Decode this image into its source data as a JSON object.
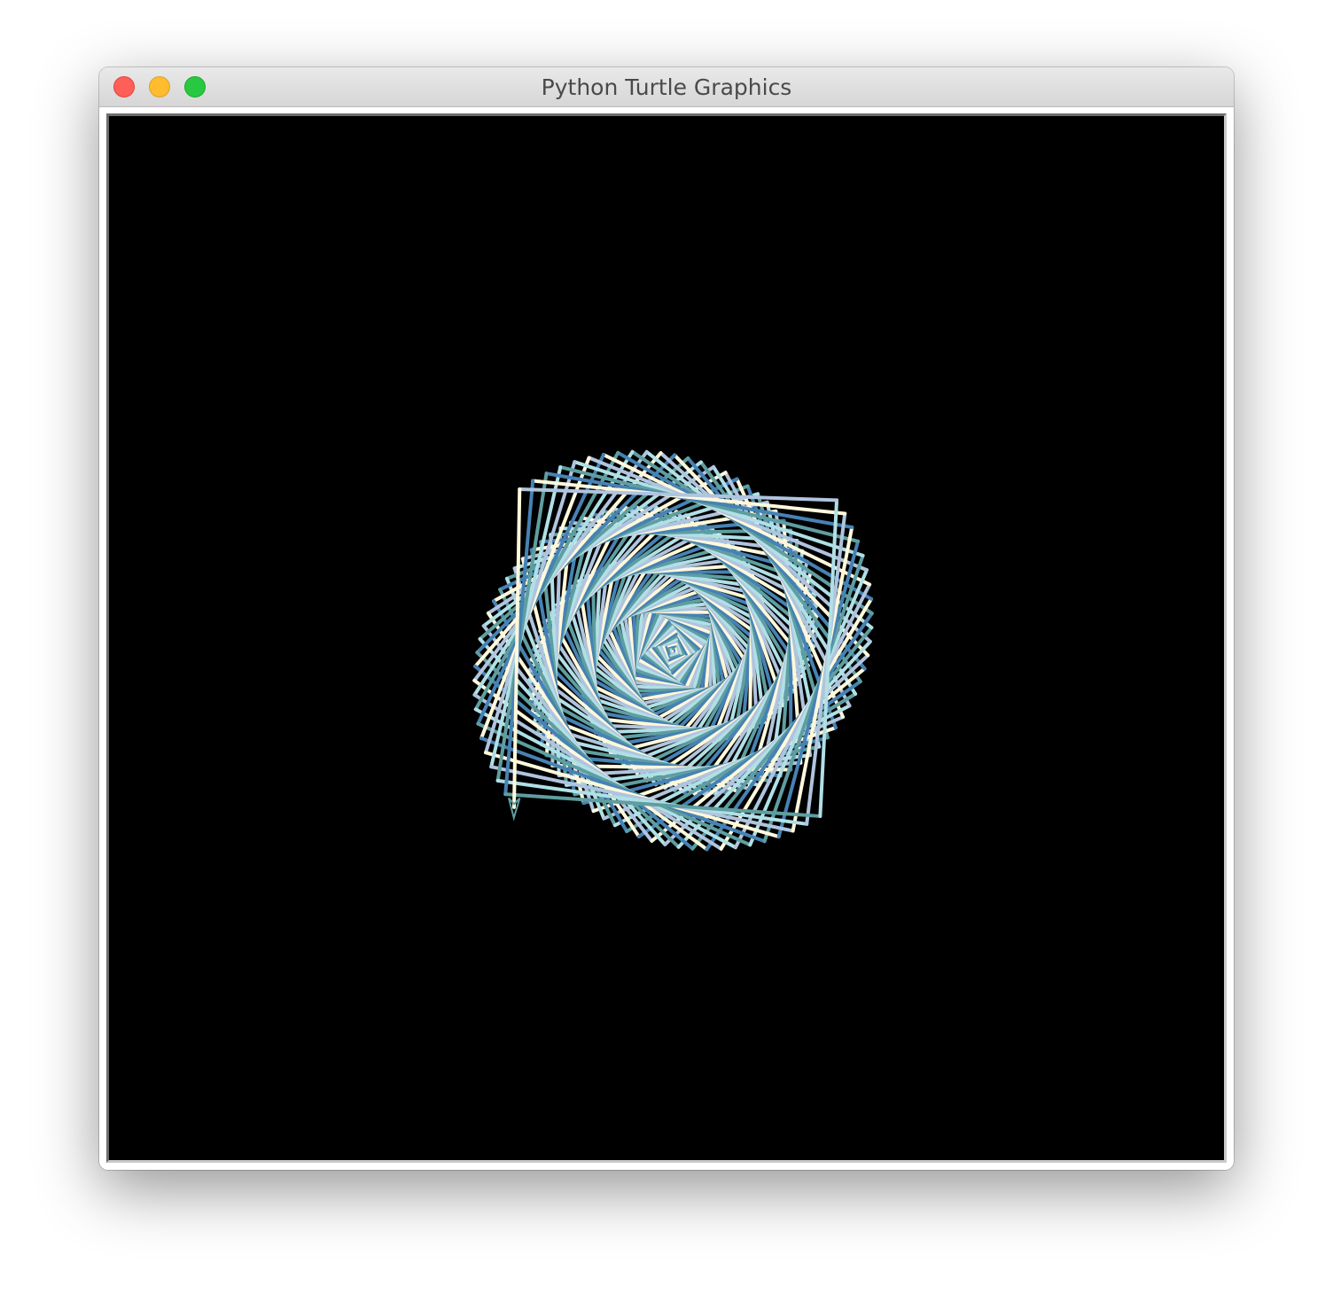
{
  "window": {
    "title": "Python Turtle Graphics"
  },
  "canvas": {
    "background": "#000000"
  },
  "drawing": {
    "pattern": "spiral-of-squares",
    "colors": [
      "#4682b4",
      "#5f9ea0",
      "#b0e0e6",
      "#b0c4de",
      "#fff8dc"
    ],
    "turtle_icon": "arrow-cursor-icon"
  }
}
